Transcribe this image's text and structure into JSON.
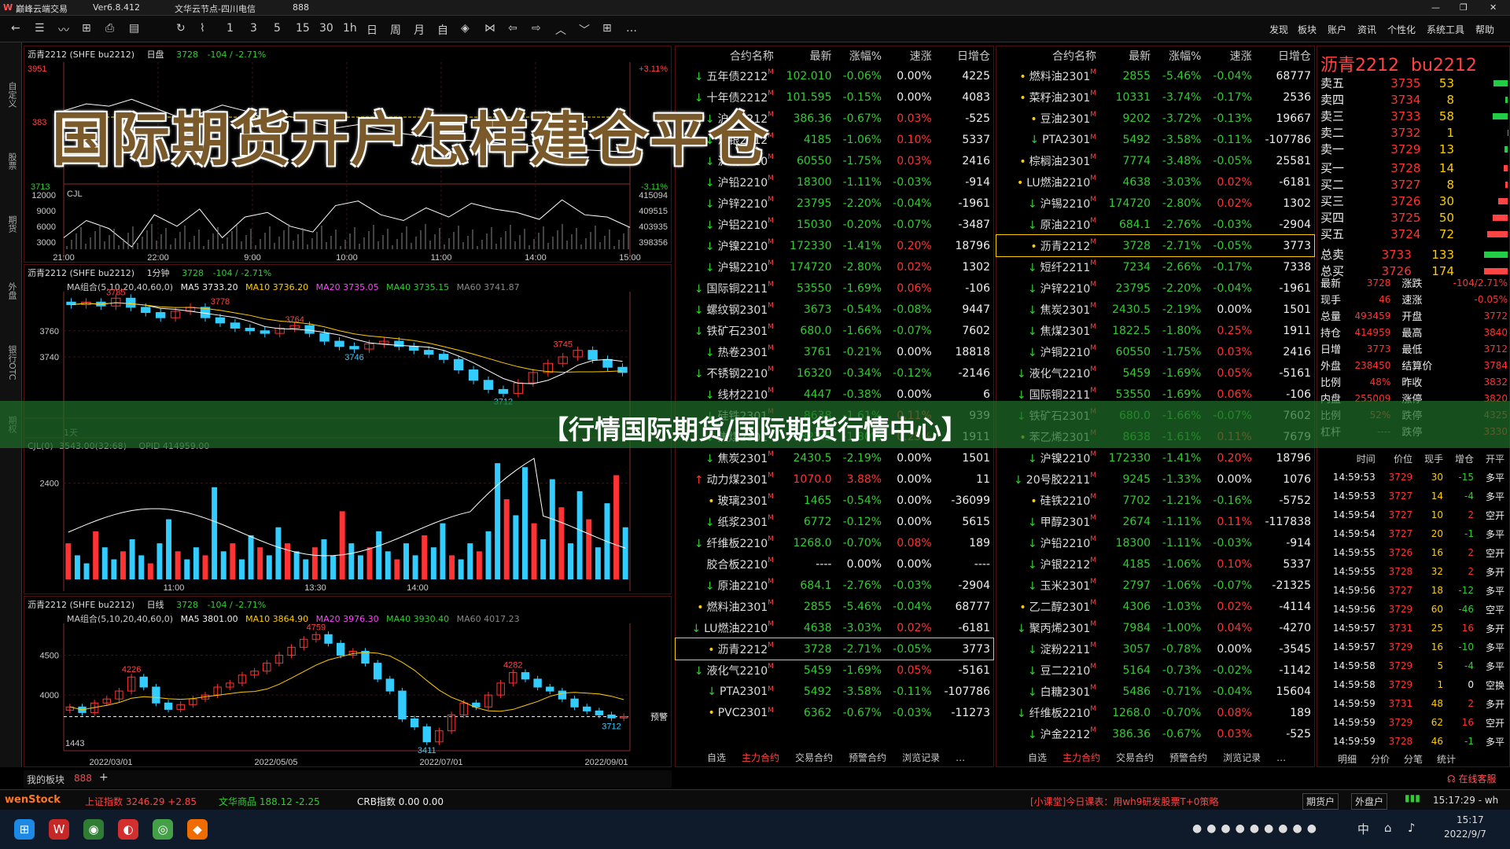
{
  "window": {
    "app_title": "巅峰云端交易",
    "version": "Ver6.8.412",
    "node": "文华云节点-四川电信",
    "code": "888",
    "controls": [
      "—",
      "❐",
      "✕"
    ]
  },
  "toolbar": {
    "icons": [
      "←",
      "☰",
      "〰",
      "⊞",
      "⎙",
      "▤",
      "↻",
      "⌇"
    ],
    "periods": [
      "1",
      "3",
      "5",
      "15",
      "30",
      "1h",
      "日",
      "周",
      "月",
      "自"
    ],
    "more": "…",
    "menus": [
      "发现",
      "板块",
      "账户",
      "资讯",
      "个性化",
      "系统工具",
      "帮助"
    ]
  },
  "leftbar": [
    "自定义",
    "股票",
    "期货",
    "外盘",
    "银行OTC",
    "期权"
  ],
  "overlay": {
    "title": "国际期货开户怎样建仓平仓",
    "banner": "【行情国际期货/国际期货行情中心】"
  },
  "chart_data": [
    {
      "type": "line",
      "panel": "intraday",
      "header": "沥青2212",
      "exchange": "(SHFE bu2212)",
      "period": "日盘",
      "last": "3728",
      "change": "-104 / -2.71%",
      "price_labels": [
        "3951",
        "383",
        "3713"
      ],
      "pct_labels": [
        "+3.11%",
        "-3.11%"
      ],
      "vol_axis": [
        "12000",
        "9000",
        "6000",
        "3000"
      ],
      "oi_axis": [
        "415094",
        "409515",
        "403935",
        "398356"
      ],
      "oi_label": "CJL",
      "time_axis": [
        "21:00",
        "22:00",
        "9:00",
        "10:00",
        "11:00",
        "14:00",
        "15:00"
      ],
      "price": [
        3800,
        3812,
        3808,
        3820,
        3805,
        3790,
        3795,
        3810,
        3800,
        3785,
        3790,
        3780,
        3770,
        3776,
        3768,
        3760,
        3755,
        3750,
        3748,
        3745,
        3740,
        3738,
        3735,
        3732,
        3730,
        3728
      ],
      "oi": [
        411000,
        412500,
        411800,
        410200,
        413000,
        412000,
        413500,
        411000,
        412800,
        413200,
        412000,
        411500,
        413800,
        414200,
        413000,
        412500,
        413600,
        412800,
        414000,
        413500,
        413200,
        412600,
        414300,
        413000,
        412800,
        411900
      ]
    },
    {
      "type": "candlestick",
      "panel": "1min",
      "header": "沥青2212",
      "exchange": "(SHFE bu2212)",
      "period": "1分钟",
      "last": "3728",
      "change": "-104 / -2.71%",
      "ma_line": "MA组合(5,10,20,40,60,0)",
      "ma5": "MA5 3733.20",
      "ma10": "MA10 3736.20",
      "ma20": "MA20 3735.05",
      "ma40": "MA40 3735.15",
      "ma60": "MA60 3741.87",
      "y_axis": [
        "3760",
        "3740"
      ],
      "annotations": [
        "3785",
        "3778",
        "3764",
        "3746",
        "3745",
        "3712"
      ],
      "closes": [
        3780,
        3782,
        3779,
        3785,
        3778,
        3774,
        3770,
        3775,
        3778,
        3770,
        3766,
        3762,
        3760,
        3758,
        3762,
        3764,
        3758,
        3752,
        3748,
        3746,
        3750,
        3752,
        3748,
        3745,
        3742,
        3738,
        3730,
        3722,
        3715,
        3712,
        3720,
        3728,
        3735,
        3740,
        3745,
        3738,
        3732,
        3728
      ]
    },
    {
      "type": "bar",
      "panel": "volume",
      "header_label": "CJL(0)",
      "cjl": "3543.00(32:68)",
      "opid": "OPID 414959.00",
      "period_label": "1天",
      "y_axis": [
        "2400"
      ],
      "time_axis": [
        "11:00",
        "13:30",
        "14:00"
      ],
      "values": [
        900,
        600,
        400,
        1200,
        800,
        500,
        700,
        1000,
        600,
        400,
        900,
        1500,
        700,
        500,
        800,
        600,
        2300,
        700,
        900,
        500,
        1100,
        800,
        600,
        1300,
        900,
        700,
        500,
        800,
        1000,
        600,
        1700,
        900,
        600,
        800,
        1200,
        700,
        500,
        900,
        600,
        1100,
        800,
        1400,
        600,
        500,
        900,
        700,
        1200,
        2900,
        2000,
        1600,
        2800,
        1400,
        1000,
        2500,
        1800,
        900,
        2200,
        1500,
        800,
        1900,
        2600,
        1300
      ]
    },
    {
      "type": "candlestick",
      "panel": "daily",
      "header": "沥青2212",
      "exchange": "(SHFE bu2212)",
      "period": "日线",
      "last": "3728",
      "change": "-104 / -2.71%",
      "ma_line": "MA组合(5,10,20,40,60,0)",
      "ma5": "MA5 3801.00",
      "ma10": "MA10 3864.90",
      "ma20": "MA20 3976.30",
      "ma40": "MA40 3930.40",
      "ma60": "MA60 4017.23",
      "y_axis": [
        "4500",
        "4000"
      ],
      "annotations": [
        "4759",
        "4226",
        "4282",
        "3411",
        "3712",
        "1443",
        "预警"
      ],
      "x_axis": [
        "2022/03/01",
        "2022/05/05",
        "2022/07/01",
        "2022/09/01"
      ],
      "closes": [
        3850,
        3780,
        3900,
        3950,
        4050,
        4226,
        4100,
        3900,
        3820,
        3880,
        3950,
        4000,
        4100,
        4150,
        4250,
        4300,
        4400,
        4500,
        4600,
        4700,
        4759,
        4650,
        4500,
        4550,
        4400,
        4200,
        4050,
        3700,
        3600,
        3411,
        3550,
        3750,
        3900,
        3850,
        4000,
        4150,
        4282,
        4200,
        4100,
        4050,
        3950,
        3850,
        3800,
        3750,
        3712,
        3728
      ]
    }
  ],
  "quote_left": {
    "headers": [
      "合约名称",
      "最新",
      "涨幅%",
      "速涨",
      "日增仓"
    ],
    "rows": [
      [
        "↓",
        "五年债2212",
        "102.010",
        "-0.06%",
        "0.00%",
        "4225"
      ],
      [
        "↓",
        "十年债2212",
        "101.595",
        "-0.15%",
        "0.00%",
        "4083"
      ],
      [
        "↓",
        "沪金2212",
        "386.36",
        "-0.67%",
        "0.03%",
        "-525"
      ],
      [
        "↓",
        "沪银2212",
        "4185",
        "-1.06%",
        "0.10%",
        "5337"
      ],
      [
        "↓",
        "沪铜2210",
        "60550",
        "-1.75%",
        "0.03%",
        "2416"
      ],
      [
        "↓",
        "沪铅2210",
        "18300",
        "-1.11%",
        "-0.03%",
        "-914"
      ],
      [
        "↓",
        "沪锌2210",
        "23795",
        "-2.20%",
        "-0.04%",
        "-1961"
      ],
      [
        "↓",
        "沪铝2210",
        "15030",
        "-0.20%",
        "-0.07%",
        "-3487"
      ],
      [
        "↓",
        "沪镍2210",
        "172330",
        "-1.41%",
        "0.20%",
        "18796"
      ],
      [
        "↓",
        "沪锡2210",
        "174720",
        "-2.80%",
        "0.02%",
        "1302"
      ],
      [
        "↓",
        "国际铜2211",
        "53550",
        "-1.69%",
        "0.06%",
        "-106"
      ],
      [
        "↓",
        "螺纹钢2301",
        "3673",
        "-0.54%",
        "-0.08%",
        "9447"
      ],
      [
        "↓",
        "铁矿石2301",
        "680.0",
        "-1.66%",
        "-0.07%",
        "7602"
      ],
      [
        "↓",
        "热卷2301",
        "3761",
        "-0.21%",
        "0.00%",
        "18818"
      ],
      [
        "↓",
        "不锈钢2210",
        "16320",
        "-0.34%",
        "-0.12%",
        "-2146"
      ],
      [
        "↓",
        "线材2210",
        "4447",
        "-0.38%",
        "0.00%",
        "6"
      ],
      [
        "↓",
        "硅铁2301",
        "8638",
        "-1.61%",
        "0.11%",
        "939"
      ],
      [
        "↓",
        "焦煤2301",
        "1822.5",
        "-1.80%",
        "0.25%",
        "1911"
      ],
      [
        "↓",
        "焦炭2301",
        "2430.5",
        "-2.19%",
        "0.00%",
        "1501"
      ],
      [
        "↑",
        "动力煤2301",
        "1070.0",
        "3.88%",
        "0.00%",
        "11"
      ],
      [
        "•",
        "玻璃2301",
        "1465",
        "-0.54%",
        "0.00%",
        "-36099"
      ],
      [
        "↓",
        "纸浆2301",
        "6772",
        "-0.12%",
        "0.00%",
        "5615"
      ],
      [
        "↓",
        "纤维板2210",
        "1268.0",
        "-0.70%",
        "0.08%",
        "189"
      ],
      [
        " ",
        "胶合板2210",
        "----",
        "0.00%",
        "0.00%",
        "----"
      ],
      [
        "↓",
        "原油2210",
        "684.1",
        "-2.76%",
        "-0.03%",
        "-2904"
      ],
      [
        "•",
        "燃料油2301",
        "2855",
        "-5.46%",
        "-0.04%",
        "68777"
      ],
      [
        "↓",
        "LU燃油2210",
        "4638",
        "-3.03%",
        "0.02%",
        "-6181"
      ],
      [
        "•",
        "沥青2212",
        "3728",
        "-2.71%",
        "-0.05%",
        "3773"
      ],
      [
        "↓",
        "液化气2210",
        "5459",
        "-1.69%",
        "0.05%",
        "-5161"
      ],
      [
        "↓",
        "PTA2301",
        "5492",
        "-3.58%",
        "-0.11%",
        "-107786"
      ],
      [
        "•",
        "PVC2301",
        "6362",
        "-0.67%",
        "-0.03%",
        "-11273"
      ]
    ]
  },
  "quote_right": {
    "headers": [
      "合约名称",
      "最新",
      "涨幅%",
      "速涨",
      "日增仓"
    ],
    "rows": [
      [
        "•",
        "燃料油2301",
        "2855",
        "-5.46%",
        "-0.04%",
        "68777"
      ],
      [
        "•",
        "菜籽油2301",
        "10331",
        "-3.74%",
        "-0.17%",
        "2536"
      ],
      [
        "•",
        "豆油2301",
        "9202",
        "-3.72%",
        "-0.13%",
        "19667"
      ],
      [
        "↓",
        "PTA2301",
        "5492",
        "-3.58%",
        "-0.11%",
        "-107786"
      ],
      [
        "•",
        "棕榈油2301",
        "7774",
        "-3.48%",
        "-0.05%",
        "25581"
      ],
      [
        "•",
        "LU燃油2210",
        "4638",
        "-3.03%",
        "0.02%",
        "-6181"
      ],
      [
        "↓",
        "沪锡2210",
        "174720",
        "-2.80%",
        "0.02%",
        "1302"
      ],
      [
        "↓",
        "原油2210",
        "684.1",
        "-2.76%",
        "-0.03%",
        "-2904"
      ],
      [
        "•",
        "沥青2212",
        "3728",
        "-2.71%",
        "-0.05%",
        "3773"
      ],
      [
        "↓",
        "短纤2211",
        "7234",
        "-2.66%",
        "-0.17%",
        "7338"
      ],
      [
        "↓",
        "沪锌2210",
        "23795",
        "-2.20%",
        "-0.04%",
        "-1961"
      ],
      [
        "↓",
        "焦炭2301",
        "2430.5",
        "-2.19%",
        "0.00%",
        "1501"
      ],
      [
        "↓",
        "焦煤2301",
        "1822.5",
        "-1.80%",
        "0.25%",
        "1911"
      ],
      [
        "↓",
        "沪铜2210",
        "60550",
        "-1.75%",
        "0.03%",
        "2416"
      ],
      [
        "↓",
        "液化气2210",
        "5459",
        "-1.69%",
        "0.05%",
        "-5161"
      ],
      [
        "↓",
        "国际铜2211",
        "53550",
        "-1.69%",
        "0.06%",
        "-106"
      ],
      [
        "↓",
        "铁矿石2301",
        "680.0",
        "-1.66%",
        "-0.07%",
        "7602"
      ],
      [
        "•",
        "苯乙烯2301",
        "8638",
        "-1.61%",
        "0.11%",
        "7679"
      ],
      [
        "↓",
        "沪镍2210",
        "172330",
        "-1.41%",
        "0.20%",
        "18796"
      ],
      [
        "↓",
        "20号胶2211",
        "9245",
        "-1.33%",
        "0.00%",
        "1076"
      ],
      [
        "•",
        "硅铁2210",
        "7702",
        "-1.21%",
        "-0.16%",
        "-5752"
      ],
      [
        "↓",
        "甲醇2301",
        "2674",
        "-1.11%",
        "0.11%",
        "-117838"
      ],
      [
        "↓",
        "沪铅2210",
        "18300",
        "-1.11%",
        "-0.03%",
        "-914"
      ],
      [
        "↓",
        "沪银2212",
        "4185",
        "-1.06%",
        "0.10%",
        "5337"
      ],
      [
        "↓",
        "玉米2301",
        "2797",
        "-1.06%",
        "-0.07%",
        "-21325"
      ],
      [
        "•",
        "乙二醇2301",
        "4306",
        "-1.03%",
        "0.02%",
        "-4114"
      ],
      [
        "↓",
        "聚丙烯2301",
        "7984",
        "-1.00%",
        "0.04%",
        "-4270"
      ],
      [
        "↓",
        "淀粉2211",
        "3057",
        "-0.78%",
        "0.00%",
        "-3545"
      ],
      [
        "↓",
        "豆二2210",
        "5164",
        "-0.73%",
        "-0.02%",
        "-1142"
      ],
      [
        "↓",
        "白糖2301",
        "5486",
        "-0.71%",
        "-0.04%",
        "15604"
      ],
      [
        "↓",
        "纤维板2210",
        "1268.0",
        "-0.70%",
        "0.08%",
        "189"
      ],
      [
        "↓",
        "沪金2212",
        "386.36",
        "-0.67%",
        "0.03%",
        "-525"
      ]
    ]
  },
  "bottom_tabs": [
    "自选",
    "主力合约",
    "交易合约",
    "预警合约",
    "浏览记录",
    "…"
  ],
  "orderbook": {
    "title": "沥青2212",
    "code": "bu2212",
    "asks": [
      [
        "卖五",
        "3735",
        "53"
      ],
      [
        "卖四",
        "3734",
        "8"
      ],
      [
        "卖三",
        "3733",
        "58"
      ],
      [
        "卖二",
        "3732",
        "1"
      ],
      [
        "卖一",
        "3729",
        "13"
      ]
    ],
    "bids": [
      [
        "买一",
        "3728",
        "14"
      ],
      [
        "买二",
        "3727",
        "8"
      ],
      [
        "买三",
        "3726",
        "30"
      ],
      [
        "买四",
        "3725",
        "50"
      ],
      [
        "买五",
        "3724",
        "72"
      ]
    ],
    "totals": [
      [
        "总卖",
        "3733",
        "133"
      ],
      [
        "总买",
        "3726",
        "174"
      ]
    ],
    "stats": [
      [
        "最新",
        "3728",
        "涨跌",
        "-104/2.71%"
      ],
      [
        "现手",
        "46",
        "速涨",
        "-0.05%"
      ],
      [
        "总量",
        "493459",
        "开盘",
        "3772"
      ],
      [
        "持仓",
        "414959",
        "最高",
        "3840"
      ],
      [
        "日增",
        "3773",
        "最低",
        "3712"
      ],
      [
        "外盘",
        "238450",
        "结算价",
        "3784"
      ],
      [
        "比例",
        "48%",
        "昨收",
        "3832"
      ],
      [
        "内盘",
        "255009",
        "涨停",
        "3820"
      ],
      [
        "比例",
        "52%",
        "跌停",
        "4325"
      ],
      [
        "杠杆",
        "----",
        "跌停",
        "3330"
      ]
    ]
  },
  "ticks": {
    "headers": [
      "时间",
      "价位",
      "现手",
      "增仓",
      "开平"
    ],
    "rows": [
      [
        "14:59:53",
        "3729",
        "30",
        "-15",
        "多平"
      ],
      [
        "14:59:53",
        "3727",
        "14",
        "-4",
        "多平"
      ],
      [
        "14:59:54",
        "3727",
        "10",
        "2",
        "空开"
      ],
      [
        "14:59:54",
        "3727",
        "20",
        "-1",
        "多平"
      ],
      [
        "14:59:55",
        "3726",
        "16",
        "2",
        "空开"
      ],
      [
        "14:59:55",
        "3728",
        "32",
        "2",
        "多开"
      ],
      [
        "14:59:56",
        "3727",
        "18",
        "-12",
        "多平"
      ],
      [
        "14:59:56",
        "3729",
        "60",
        "-46",
        "空平"
      ],
      [
        "14:59:57",
        "3731",
        "25",
        "16",
        "多开"
      ],
      [
        "14:59:57",
        "3729",
        "16",
        "-10",
        "多平"
      ],
      [
        "14:59:58",
        "3729",
        "5",
        "-4",
        "多平"
      ],
      [
        "14:59:58",
        "3729",
        "1",
        "0",
        "空换"
      ],
      [
        "14:59:59",
        "3731",
        "48",
        "2",
        "多开"
      ],
      [
        "14:59:59",
        "3729",
        "62",
        "16",
        "空开"
      ],
      [
        "14:59:59",
        "3728",
        "46",
        "-1",
        "多平"
      ]
    ]
  },
  "tick_tabs": [
    "明细",
    "分价",
    "分笔",
    "统计"
  ],
  "service": "在线客服",
  "block_bar": {
    "label": "我的板块",
    "item": "888",
    "add": "+"
  },
  "statusbar": {
    "logo": "wenStock",
    "sh_label": "上证指数",
    "sh_val": "3246.29",
    "sh_chg": "+2.85",
    "wh_label": "文华商品",
    "wh_val": "188.12",
    "wh_chg": "-2.25",
    "crb_label": "CRB指数",
    "crb_val": "0.00",
    "crb_chg": "0.00",
    "notice": "[小课堂]今日课表：用wh9研发股票T+0策略",
    "btn1": "期货户",
    "btn2": "外盘户",
    "time": "15:17:29 - wh"
  },
  "taskbar": {
    "time": "15:17",
    "date": "2022/9/7",
    "ime": "中"
  }
}
